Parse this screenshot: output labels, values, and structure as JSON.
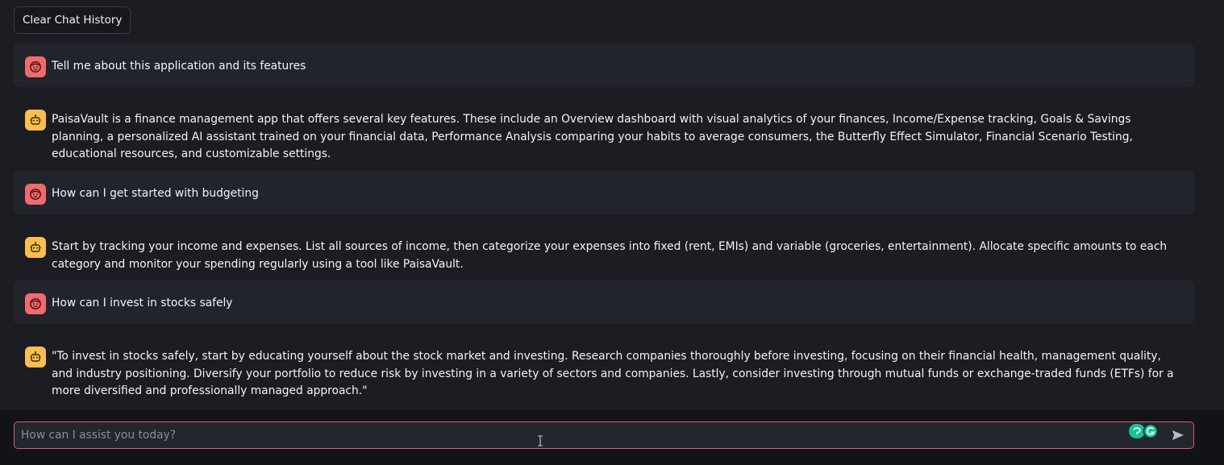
{
  "toolbar": {
    "clear_label": "Clear Chat History"
  },
  "messages": [
    {
      "role": "user",
      "icon": "user-face-icon",
      "text": "Tell me about this application and its features"
    },
    {
      "role": "bot",
      "icon": "robot-icon",
      "text": "PaisaVault is a finance management app that offers several key features. These include an Overview dashboard with visual analytics of your finances, Income/Expense tracking, Goals & Savings planning, a personalized AI assistant trained on your financial data, Performance Analysis comparing your habits to average consumers, the Butterfly Effect Simulator, Financial Scenario Testing, educational resources, and customizable settings."
    },
    {
      "role": "user",
      "icon": "user-face-icon",
      "text": "How can I get started with budgeting"
    },
    {
      "role": "bot",
      "icon": "robot-icon",
      "text": "Start by tracking your income and expenses. List all sources of income, then categorize your expenses into fixed (rent, EMIs) and variable (groceries, entertainment). Allocate specific amounts to each category and monitor your spending regularly using a tool like PaisaVault."
    },
    {
      "role": "user",
      "icon": "user-face-icon",
      "text": "How can I invest in stocks safely"
    },
    {
      "role": "bot",
      "icon": "robot-icon",
      "text": "\"To invest in stocks safely, start by educating yourself about the stock market and investing. Research companies thoroughly before investing, focusing on their financial health, management quality, and industry positioning. Diversify your portfolio to reduce risk by investing in a variety of sectors and companies. Lastly, consider investing through mutual funds or exchange-traded funds (ETFs) for a more diversified and professionally managed approach.\""
    }
  ],
  "input": {
    "placeholder": "How can I assist you today?",
    "value": ""
  },
  "colors": {
    "background": "#1b1d23",
    "user_bubble": "#22242b",
    "user_avatar": "#f16a6c",
    "bot_avatar": "#f6bf4f",
    "input_border": "#e15a63",
    "grammarly_green": "#15c39a"
  }
}
